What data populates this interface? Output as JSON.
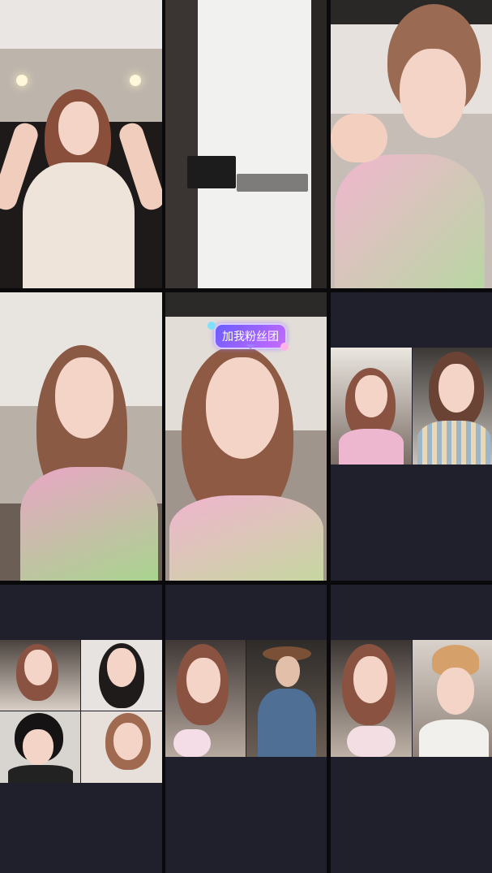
{
  "grid": {
    "tiles": [
      {
        "id": "tile-1",
        "kind": "video-feed"
      },
      {
        "id": "tile-2",
        "kind": "video-feed"
      },
      {
        "id": "tile-3",
        "kind": "video-feed"
      },
      {
        "id": "tile-4",
        "kind": "video-feed"
      },
      {
        "id": "tile-5",
        "kind": "video-feed"
      },
      {
        "id": "tile-6",
        "kind": "multi-feed"
      },
      {
        "id": "tile-7",
        "kind": "multi-feed"
      },
      {
        "id": "tile-8",
        "kind": "multi-feed"
      },
      {
        "id": "tile-9",
        "kind": "multi-feed"
      }
    ]
  },
  "overlay": {
    "fan_club_badge": "加我粉丝团"
  },
  "colors": {
    "grid_gap": "#0a0a0d",
    "empty_tile": "#1f202b",
    "badge_accent": "#8a63ff"
  }
}
